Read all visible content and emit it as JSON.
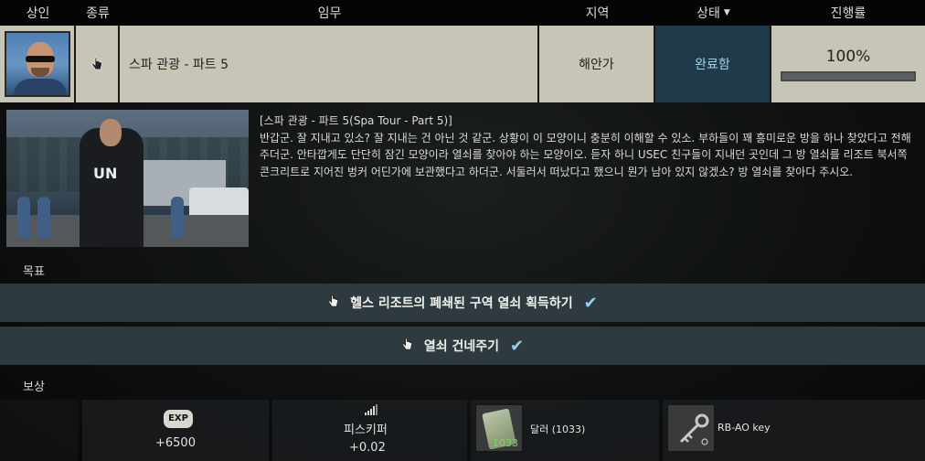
{
  "header": {
    "merchant": "상인",
    "type": "종류",
    "task": "임무",
    "location": "지역",
    "status": "상태",
    "progress": "진행률"
  },
  "quest": {
    "name": "스파 관광 - 파트 5",
    "location": "해안가",
    "status": "완료함",
    "progress_text": "100%",
    "progress_value": 1.0
  },
  "briefing": {
    "title": "[스파 관광 - 파트 5(Spa Tour - Part 5)]",
    "text": "반갑군. 잘 지내고 있소? 잘 지내는 건 아닌 것 같군. 상황이 이 모양이니 충분히 이해할 수 있소. 부하들이 꽤 흥미로운 방을 하나 찾았다고 전해주더군. 안타깝게도 단단히 잠긴 모양이라 열쇠를 찾아야 하는 모양이오. 듣자 하니 USEC 친구들이 지내던 곳인데 그 방 열쇠를 리조트 북서쪽 콘크리트로 지어진 벙커 어딘가에 보관했다고 하더군. 서둘러서 떠났다고 했으니 뭔가 남아 있지 않겠소? 방 열쇠를 찾아다 주시오."
  },
  "objectives": {
    "label": "목표",
    "items": [
      {
        "text": "헬스 리조트의 폐쇄된 구역 열쇠 획득하기"
      },
      {
        "text": "열쇠 건네주기"
      }
    ]
  },
  "rewards": {
    "label": "보상",
    "exp_badge": "EXP",
    "exp_value": "+6500",
    "rep_label": "피스키퍼",
    "rep_value": "+0.02",
    "money_name": "달러 (1033)",
    "money_qty": "1033",
    "key_name": "RB-AO key"
  },
  "colors": {
    "status_bg": "#1f3a4a",
    "status_text": "#9fd0e8",
    "row_bg": "#c7c6b6",
    "check": "#8fd3f0"
  },
  "icons": [
    "chevron-down-icon",
    "cursor-hand-icon",
    "check-icon",
    "exp-icon",
    "rep-signal-icon",
    "money-icon",
    "key-icon"
  ]
}
